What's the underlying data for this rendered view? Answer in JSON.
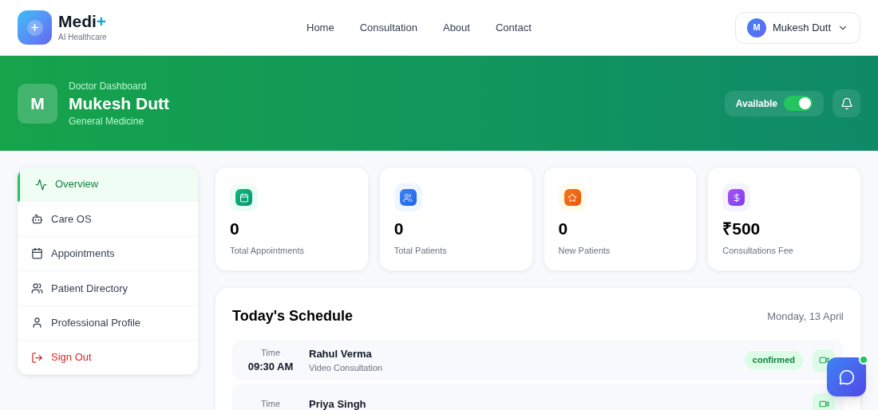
{
  "brand": {
    "name": "Medi",
    "plus": "+",
    "tagline": "AI Healthcare"
  },
  "nav": [
    "Home",
    "Consultation",
    "About",
    "Contact"
  ],
  "user_menu": {
    "initial": "M",
    "name": "Mukesh Dutt"
  },
  "banner": {
    "initial": "M",
    "subtitle": "Doctor Dashboard",
    "name": "Mukesh Dutt",
    "specialty": "General Medicine",
    "availability": {
      "label": "Available",
      "on": true
    }
  },
  "sidebar": {
    "items": [
      {
        "kind": "activity",
        "label": "Overview",
        "selected": true
      },
      {
        "kind": "bot",
        "label": "Care OS",
        "selected": false
      },
      {
        "kind": "calendar",
        "label": "Appointments",
        "selected": false
      },
      {
        "kind": "users",
        "label": "Patient Directory",
        "selected": false
      },
      {
        "kind": "user",
        "label": "Professional Profile",
        "selected": false
      },
      {
        "kind": "signout",
        "label": "Sign Out",
        "selected": false
      }
    ]
  },
  "stats": [
    {
      "kind": "calendar",
      "value": "0",
      "label": "Total Appointments"
    },
    {
      "kind": "users",
      "value": "0",
      "label": "Total Patients"
    },
    {
      "kind": "star",
      "value": "0",
      "label": "New Patients"
    },
    {
      "kind": "dollar",
      "value": "₹500",
      "label": "Consultations Fee"
    }
  ],
  "schedule": {
    "title": "Today's Schedule",
    "date": "Monday, 13 April",
    "rows": [
      {
        "time_label": "Time",
        "time": "09:30 AM",
        "patient": "Rahul Verma",
        "type": "Video Consultation",
        "status": "confirmed"
      },
      {
        "time_label": "Time",
        "time": "",
        "patient": "Priya Singh",
        "type": "",
        "status": ""
      }
    ]
  }
}
